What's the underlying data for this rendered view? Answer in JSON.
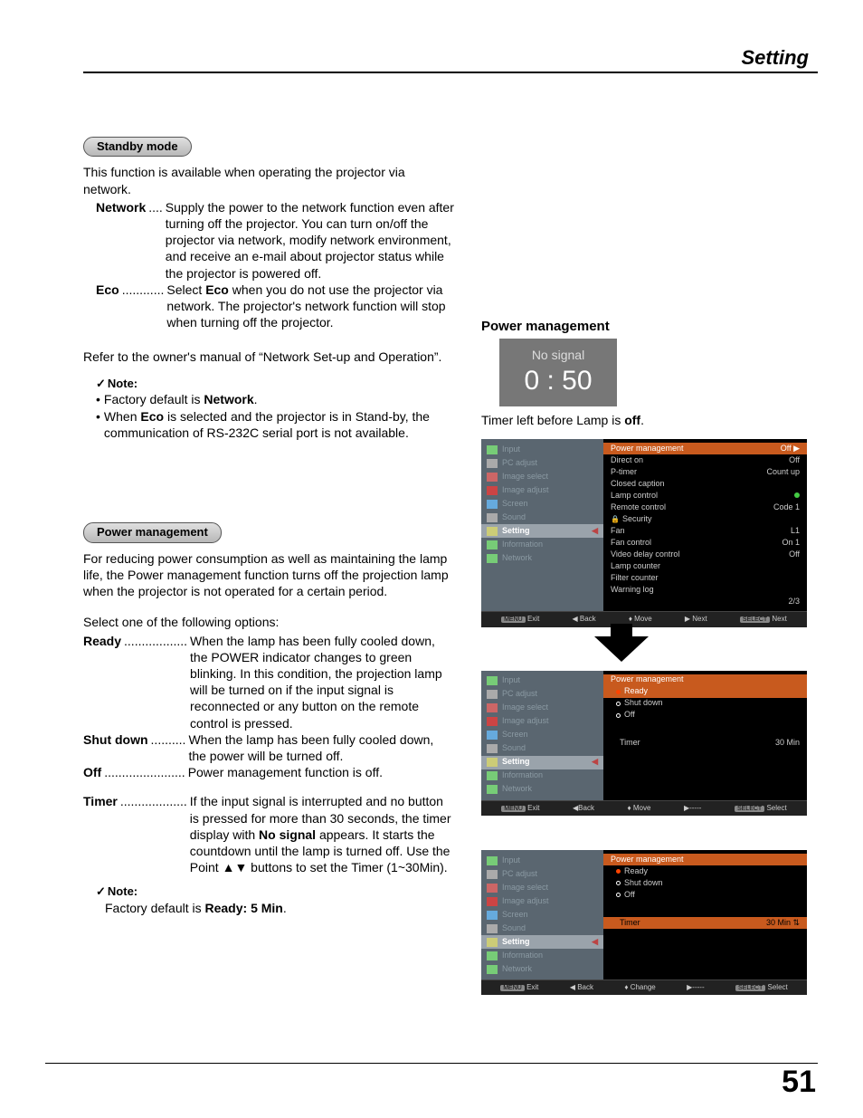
{
  "header": {
    "title": "Setting"
  },
  "pageNumber": "51",
  "standby": {
    "pillLabel": "Standby mode",
    "intro": "This function is available when operating the projector via network.",
    "network": {
      "label": "Network",
      "dots": " .... ",
      "body": "Supply the power to the network function even after turning off the projector. You can turn on/off the projector via network, modify network environment, and receive an e-mail about projector status while the projector is powered off."
    },
    "eco": {
      "label": "Eco",
      "dots": " ............ ",
      "body1": "Select ",
      "body1b": "Eco",
      "body2": " when you do not use the projector via network. The projector's network function will stop when turning off the projector."
    },
    "refer": "Refer to the owner's manual of “Network Set-up and Operation”.",
    "noteHead": "Note:",
    "note1a": "Factory default is ",
    "note1b": "Network",
    "note1c": ".",
    "note2a": "When ",
    "note2b": "Eco",
    "note2c": " is selected and the projector is in Stand-by, the communication of RS-232C serial port is not available."
  },
  "power": {
    "pillLabel": "Power management",
    "intro": "For reducing power consumption as well as maintaining the lamp life, the Power management function turns off the projection lamp when the projector is not operated for a certain period.",
    "selectLine": "Select one of the following options:",
    "ready": {
      "label": "Ready",
      "dots": ".................. ",
      "body": "When the lamp has been fully cooled down, the POWER indicator changes to green blinking. In this condition, the projection lamp will be turned on if the input signal is reconnected or any button on the remote control is pressed."
    },
    "shutdown": {
      "label": "Shut down",
      "dots": " .......... ",
      "body": "When the lamp has been fully cooled down, the power will be turned off."
    },
    "off": {
      "label": "Off",
      "dots": " ....................... ",
      "body": "Power management function is off."
    },
    "timer": {
      "label": "Timer",
      "dots": "................... ",
      "body1": "If the input signal is interrupted and no button is pressed for more than 30 seconds, the timer display with ",
      "body1b": "No signal",
      "body2": " appears. It starts the countdown until the lamp is turned off. Use the Point ▲▼ buttons to set the Timer (1~30Min)."
    },
    "noteHead": "Note:",
    "noteBody1": "Factory default is ",
    "noteBody1b": "Ready: 5 Min",
    "noteBody1c": "."
  },
  "right": {
    "heading": "Power management",
    "nosignalLabel": "No signal",
    "nosignalTime": "0 : 50",
    "caption1": "Timer left before Lamp is ",
    "caption1b": "off",
    "caption1c": "."
  },
  "osdLeft": {
    "items": [
      "Input",
      "PC adjust",
      "Image select",
      "Image adjust",
      "Screen",
      "Sound",
      "Setting",
      "Information",
      "Network"
    ],
    "selected": "Setting"
  },
  "osd1": {
    "rows": [
      {
        "l": "Power management",
        "r": "Off",
        "hl": true
      },
      {
        "l": "Direct on",
        "r": "Off"
      },
      {
        "l": "P-timer",
        "r": "Count up"
      },
      {
        "l": "Closed caption",
        "r": ""
      },
      {
        "l": "Lamp control",
        "r": "",
        "green": true
      },
      {
        "l": "Remote control",
        "r": "Code 1"
      },
      {
        "l": "Security",
        "r": "",
        "lock": true
      },
      {
        "l": "Fan",
        "r": "L1"
      },
      {
        "l": "Fan control",
        "r": "On 1"
      },
      {
        "l": "Video delay control",
        "r": "Off"
      },
      {
        "l": "Lamp counter",
        "r": ""
      },
      {
        "l": "Filter counter",
        "r": ""
      },
      {
        "l": "Warning log",
        "r": ""
      }
    ],
    "page": "2/3",
    "bottom": {
      "exit": "Exit",
      "back": "Back",
      "move": "Move",
      "next": "Next",
      "selnext": "Next",
      "menuBtn": "MENU",
      "selBtn": "SELECT"
    }
  },
  "osd2": {
    "head": {
      "l": "Power management",
      "r": ""
    },
    "rows": [
      {
        "l": "Ready",
        "radio": "fill",
        "red": true
      },
      {
        "l": "Shut down",
        "radio": "empty"
      },
      {
        "l": "Off",
        "radio": "empty"
      }
    ],
    "timerRow": {
      "l": "Timer",
      "r": "30 Min"
    },
    "bottom": {
      "exit": "Exit",
      "back": "Back",
      "move": "Move",
      "dash": "-----",
      "sel": "Select",
      "menuBtn": "MENU",
      "selBtn": "SELECT"
    }
  },
  "osd3": {
    "head": {
      "l": "Power management",
      "r": ""
    },
    "rows": [
      {
        "l": "Ready",
        "radio": "fill",
        "red": true
      },
      {
        "l": "Shut down",
        "radio": "empty"
      },
      {
        "l": "Off",
        "radio": "empty"
      }
    ],
    "timerRow": {
      "l": "Timer",
      "r": "30 Min",
      "hl": true,
      "spin": true
    },
    "bottom": {
      "exit": "Exit",
      "back": "Back",
      "move": "Change",
      "dash": "-----",
      "sel": "Select",
      "menuBtn": "MENU",
      "selBtn": "SELECT"
    }
  }
}
